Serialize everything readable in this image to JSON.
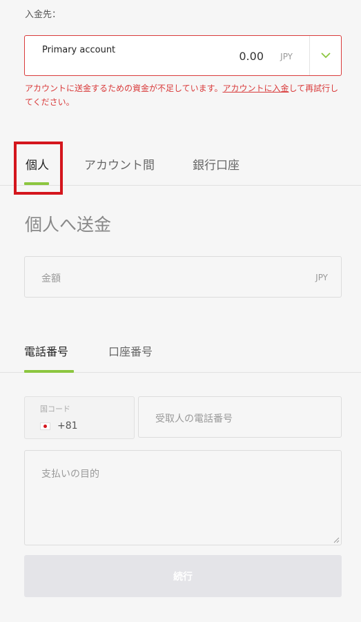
{
  "deposit": {
    "label": "入金先："
  },
  "account": {
    "name": "Primary account",
    "balance": "0.00",
    "currency": "JPY",
    "chevron_icon": "chevron-down-icon"
  },
  "error": {
    "part1": "アカウントに送金するための資金が不足しています。",
    "link": "アカウントに入金",
    "part2": "して再試行してください。"
  },
  "tabs": [
    {
      "label": "個人",
      "active": true
    },
    {
      "label": "アカウント間",
      "active": false
    },
    {
      "label": "銀行口座",
      "active": false
    }
  ],
  "section": {
    "title": "個人へ送金"
  },
  "amount": {
    "placeholder": "金額",
    "currency": "JPY"
  },
  "method_tabs": [
    {
      "label": "電話番号",
      "active": true
    },
    {
      "label": "口座番号",
      "active": false
    }
  ],
  "country": {
    "label": "国コード",
    "value": "+81",
    "flag_icon": "japan-flag-icon"
  },
  "phone": {
    "placeholder": "受取人の電話番号"
  },
  "purpose": {
    "placeholder": "支払いの目的"
  },
  "continue_button": {
    "label": "続行"
  },
  "colors": {
    "accent": "#8cc63f",
    "error": "#d93a3a",
    "highlight": "#d4161d",
    "button_disabled": "#e4e4e8"
  }
}
